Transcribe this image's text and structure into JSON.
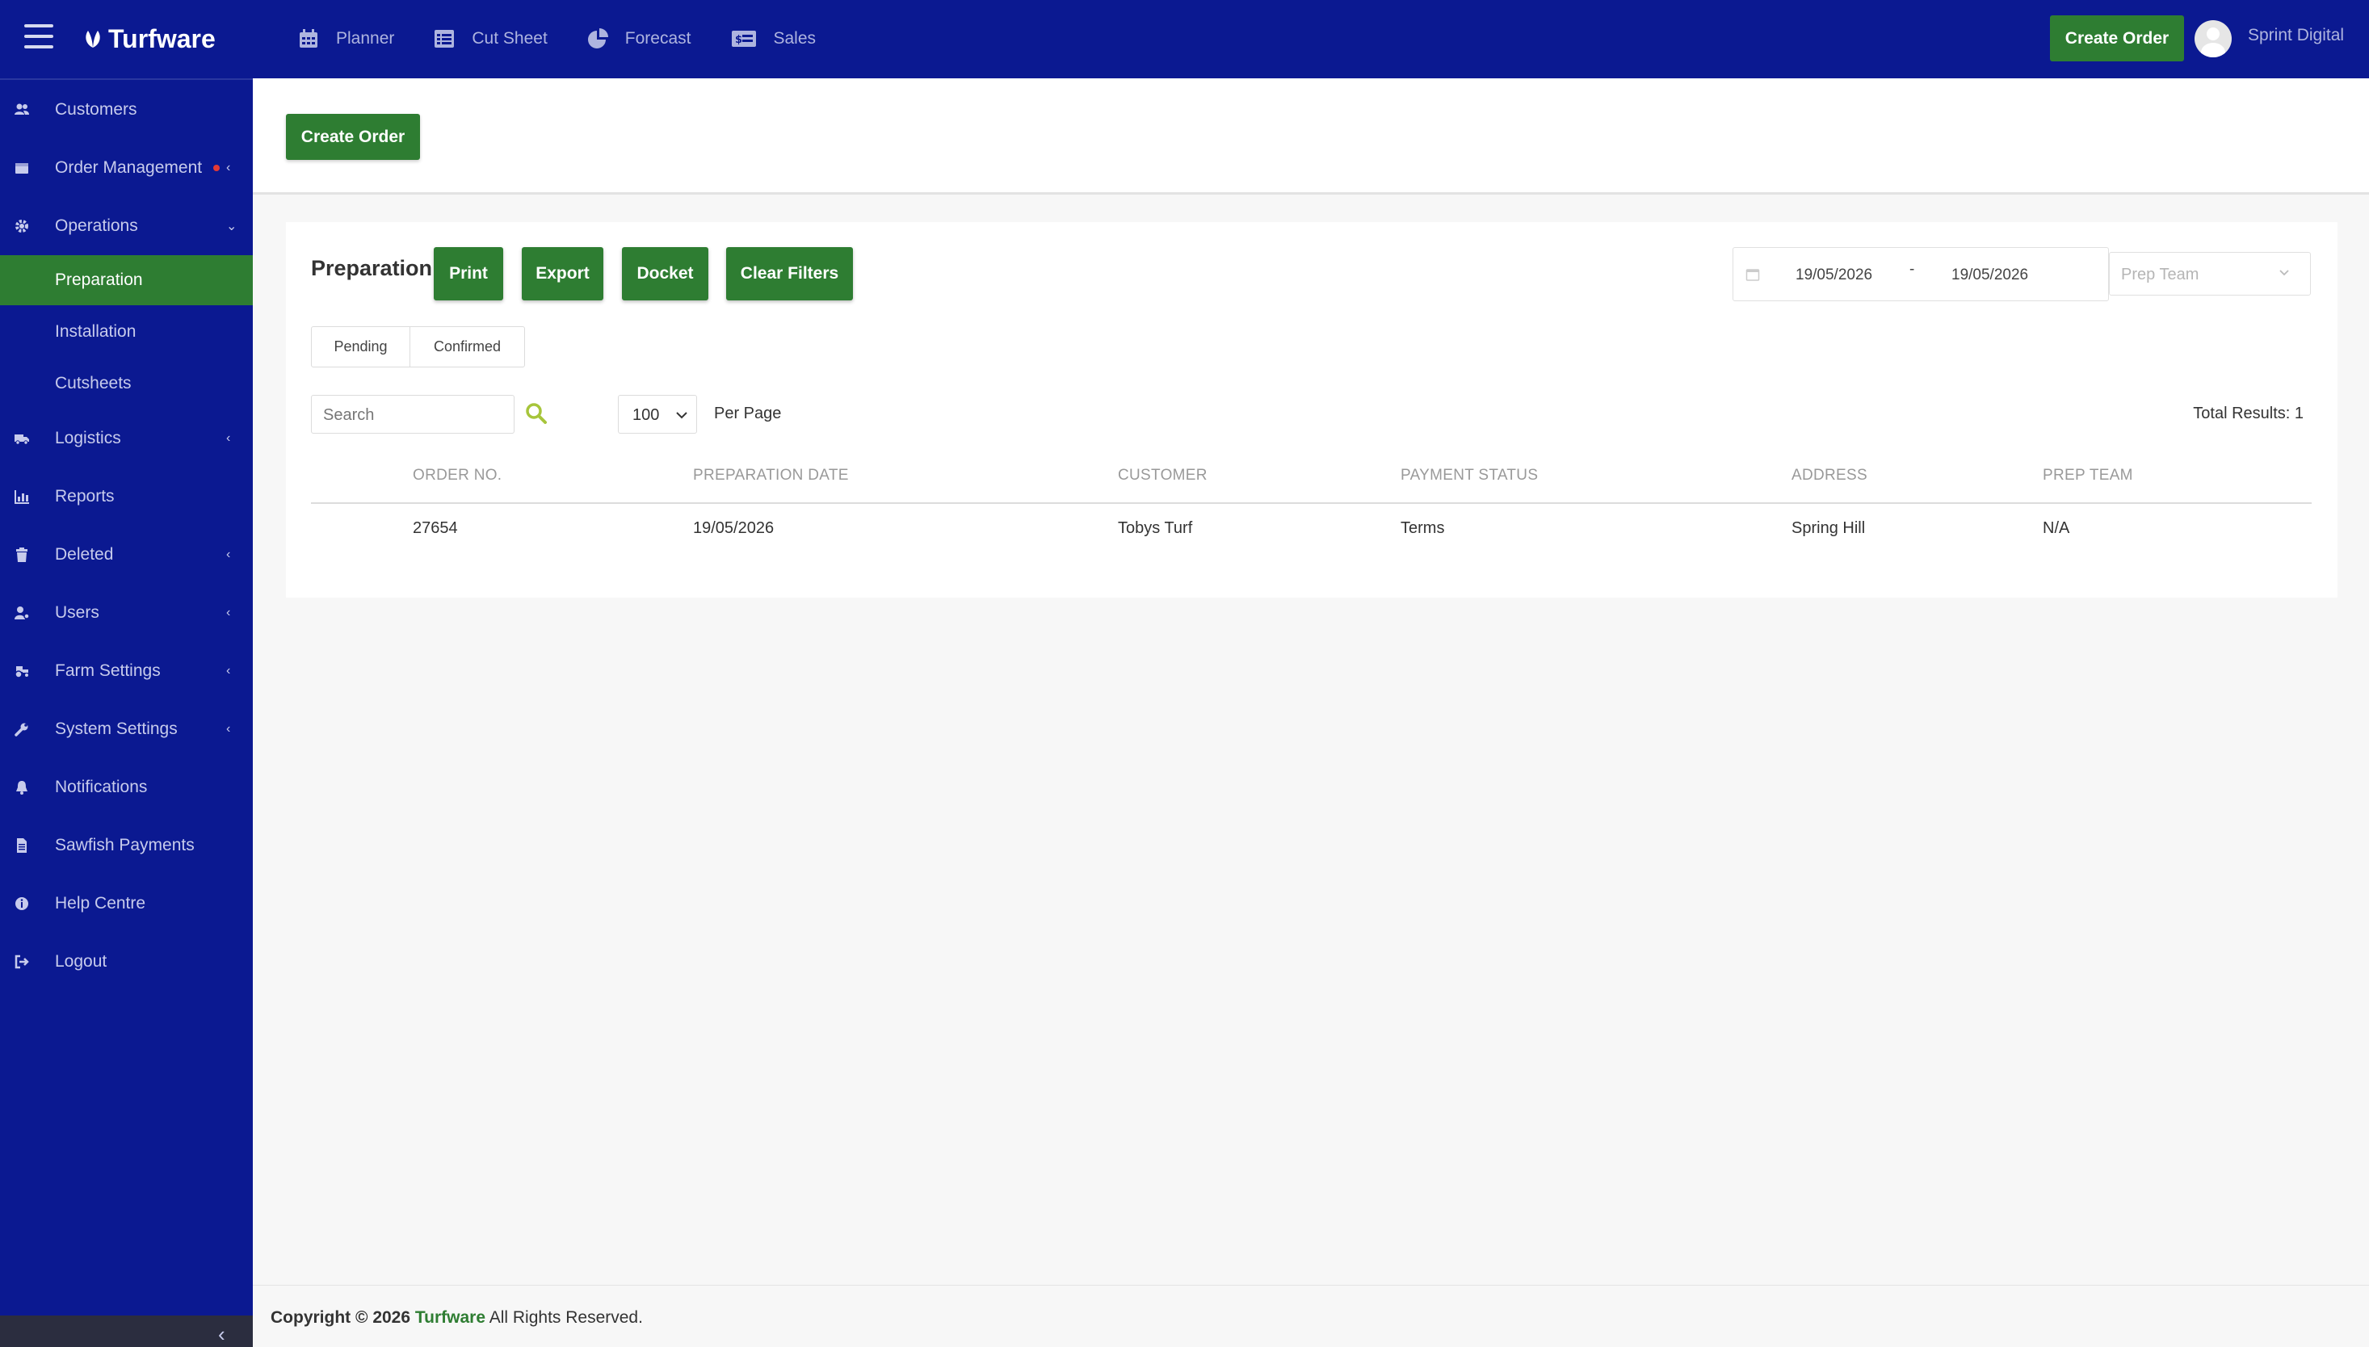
{
  "brand": {
    "name": "Turfware"
  },
  "topnav": [
    {
      "label": "Planner",
      "icon": "calendar-icon"
    },
    {
      "label": "Cut Sheet",
      "icon": "list-icon"
    },
    {
      "label": "Forecast",
      "icon": "pie-chart-icon"
    },
    {
      "label": "Sales",
      "icon": "money-icon"
    }
  ],
  "header": {
    "create_label": "Create Order",
    "user_name": "Sprint Digital"
  },
  "sidebar": {
    "items": [
      {
        "label": "Customers",
        "icon": "users-icon"
      },
      {
        "label": "Order Management",
        "icon": "box-icon"
      },
      {
        "label": "Operations",
        "icon": "gear-icon"
      },
      {
        "label": "Logistics",
        "icon": "truck-icon"
      },
      {
        "label": "Reports",
        "icon": "bar-chart-icon"
      },
      {
        "label": "Deleted",
        "icon": "trash-icon"
      },
      {
        "label": "Users",
        "icon": "user-cog-icon"
      },
      {
        "label": "Farm Settings",
        "icon": "tractor-icon"
      },
      {
        "label": "System Settings",
        "icon": "wrench-icon"
      },
      {
        "label": "Notifications",
        "icon": "bell-icon"
      },
      {
        "label": "Sawfish Payments",
        "icon": "document-icon"
      },
      {
        "label": "Help Centre",
        "icon": "info-icon"
      },
      {
        "label": "Logout",
        "icon": "logout-icon"
      }
    ],
    "subitems": [
      {
        "label": "Preparation",
        "active": true
      },
      {
        "label": "Installation",
        "active": false
      },
      {
        "label": "Cutsheets",
        "active": false
      }
    ]
  },
  "main": {
    "create_label": "Create Order",
    "title": "Preparation",
    "buttons": {
      "print": "Print",
      "export": "Export",
      "docket": "Docket",
      "clear": "Clear Filters"
    },
    "date_from": "19/05/2026",
    "date_sep": "-",
    "date_to": "19/05/2026",
    "prep_team_placeholder": "Prep Team",
    "tabs": [
      "Pending",
      "Confirmed"
    ],
    "search_placeholder": "Search",
    "per_page_value": "100",
    "per_page_label": "Per Page",
    "total_results": "Total Results: 1",
    "columns": [
      "ORDER NO.",
      "PREPARATION DATE",
      "CUSTOMER",
      "PAYMENT STATUS",
      "ADDRESS",
      "PREP TEAM"
    ],
    "rows": [
      [
        "27654",
        "19/05/2026",
        "Tobys Turf",
        "Terms",
        "Spring Hill",
        "N/A"
      ]
    ]
  },
  "footer": {
    "copyright": "Copyright ©",
    "year": "2026",
    "brand": "Turfware",
    "rights": "All Rights Reserved."
  },
  "colors": {
    "primary": "#0b1991",
    "accent": "#2e7d32",
    "search_icon": "#a7c53b"
  }
}
